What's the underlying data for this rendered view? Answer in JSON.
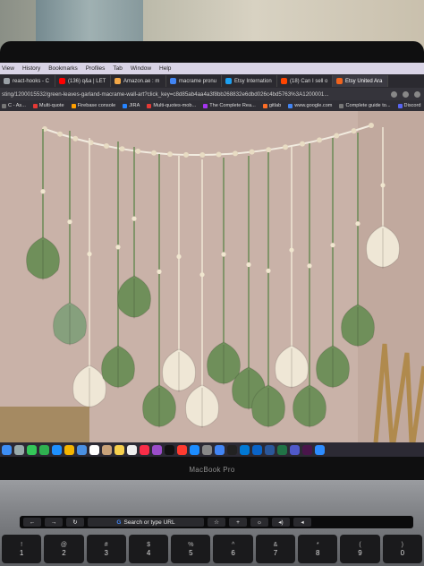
{
  "menubar": {
    "items": [
      "View",
      "History",
      "Bookmarks",
      "Profiles",
      "Tab",
      "Window",
      "Help"
    ]
  },
  "tabs": [
    {
      "label": "react-hooks - C",
      "color": "#9aa0a6"
    },
    {
      "label": "(136) q&a | LET",
      "color": "#ff0000"
    },
    {
      "label": "Amazon.ae : m",
      "color": "#f3a847"
    },
    {
      "label": "macrame pronu",
      "color": "#4285f4"
    },
    {
      "label": "Etsy Internation",
      "color": "#1da1f2"
    },
    {
      "label": "(18) Can I sell o",
      "color": "#ff4500"
    },
    {
      "label": "Etsy United Ara",
      "color": "#f1641e"
    }
  ],
  "active_tab_index": 6,
  "address": {
    "url": "sting/1200015532/green-leaves-garland-macrame-wall-art?click_key=c8d85ab4aa4a3f8bb268832e6dbd026c4bd5763%3A1200001..."
  },
  "bookmarks": [
    {
      "label": "C - As...",
      "color": "#777"
    },
    {
      "label": "Multi-quote",
      "color": "#e53935"
    },
    {
      "label": "Firebase console",
      "color": "#ffa000"
    },
    {
      "label": "JIRA",
      "color": "#2684ff"
    },
    {
      "label": "Multi-quotes-mob...",
      "color": "#e53935"
    },
    {
      "label": "The Complete Rea...",
      "color": "#a435f0"
    },
    {
      "label": "gitlab",
      "color": "#fc6d26"
    },
    {
      "label": "www.google.com",
      "color": "#4285f4"
    },
    {
      "label": "Complete guide to...",
      "color": "#777"
    },
    {
      "label": "Discord",
      "color": "#5865f2"
    }
  ],
  "brand": "MacBook Pro",
  "touchbar": {
    "search_label": "Search or type URL",
    "search_icon": "google-g-icon"
  },
  "keys": [
    {
      "top": "!",
      "bottom": "1"
    },
    {
      "top": "@",
      "bottom": "2"
    },
    {
      "top": "#",
      "bottom": "3"
    },
    {
      "top": "$",
      "bottom": "4"
    },
    {
      "top": "%",
      "bottom": "5"
    },
    {
      "top": "^",
      "bottom": "6"
    },
    {
      "top": "&",
      "bottom": "7"
    },
    {
      "top": "*",
      "bottom": "8"
    },
    {
      "top": "(",
      "bottom": "9"
    },
    {
      "top": ")",
      "bottom": "0"
    }
  ],
  "dock_icons": [
    "finder-icon",
    "launchpad-icon",
    "messages-icon",
    "facetime-icon",
    "safari-icon",
    "photos-icon",
    "mail-icon",
    "calendar-icon",
    "contacts-icon",
    "notes-icon",
    "reminders-icon",
    "music-icon",
    "podcasts-icon",
    "tv-icon",
    "news-icon",
    "appstore-icon",
    "preferences-icon",
    "chrome-icon",
    "terminal-icon",
    "vscode-icon",
    "outlook-icon",
    "word-icon",
    "excel-icon",
    "teams-icon",
    "slack-icon",
    "zoom-icon"
  ],
  "colors": {
    "leaf_green": "#6f8f5a",
    "leaf_sage": "#86a07d",
    "leaf_cream": "#efe7d6",
    "wall": "#c8b1a7"
  }
}
